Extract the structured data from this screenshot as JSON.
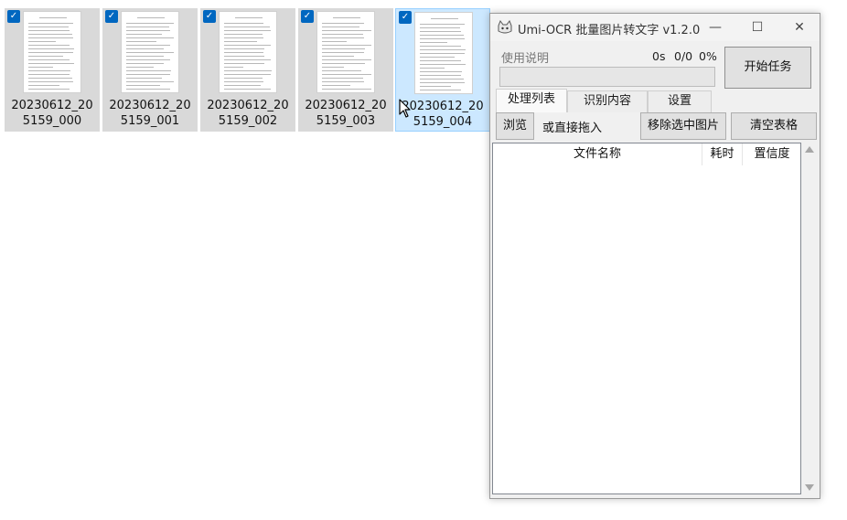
{
  "explorer": {
    "files": [
      {
        "name": "20230612_205159_000",
        "checked": true,
        "selected": false
      },
      {
        "name": "20230612_205159_001",
        "checked": true,
        "selected": false
      },
      {
        "name": "20230612_205159_002",
        "checked": true,
        "selected": false
      },
      {
        "name": "20230612_205159_003",
        "checked": true,
        "selected": false
      },
      {
        "name": "20230612_205159_004",
        "checked": true,
        "selected": true
      }
    ]
  },
  "window": {
    "title": "Umi-OCR 批量图片转文字 v1.2.0",
    "icon": "cat-icon",
    "controls": {
      "minimize": "—",
      "maximize": "☐",
      "close": "✕"
    },
    "help_link": "使用说明",
    "stats": {
      "time": "0s",
      "count": "0/0",
      "percent": "0%"
    },
    "progress": 0,
    "start_button": "开始任务",
    "tabs": [
      "处理列表",
      "识别内容",
      "设置"
    ],
    "active_tab": 0,
    "toolbar": {
      "browse": "浏览",
      "drag_hint": "或直接拖入",
      "remove_selected": "移除选中图片",
      "clear_table": "清空表格"
    },
    "table": {
      "columns": [
        "文件名称",
        "耗时",
        "置信度"
      ],
      "rows": []
    }
  },
  "colors": {
    "checkbox": "#0067c0",
    "selection": "#cce8ff",
    "selection_border": "#99d1ff",
    "progress_fill": "#06b025"
  }
}
